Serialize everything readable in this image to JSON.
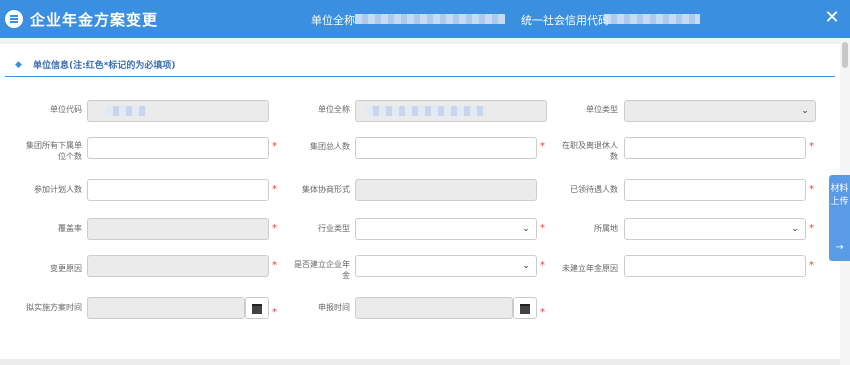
{
  "header": {
    "title": "企业年金方案变更",
    "unit_name_label": "单位全称",
    "credit_code_label": "统一社会信用代码",
    "close_label": "✕"
  },
  "section": {
    "title": "单位信息(注:红色*标记的为必填项)",
    "icon": "diamond-icon"
  },
  "form": {
    "unit_code_label": "单位代码",
    "unit_fullname_label": "单位全称",
    "unit_type_label": "单位类型",
    "subsidiary_count_label": "集团所有下属单位个数",
    "group_total_label": "集团总人数",
    "active_retired_label": "在职及离退休人数",
    "participants_label": "参加计划人数",
    "negotiation_label": "集体协商形式",
    "receiving_label": "已领待遇人数",
    "coverage_label": "覆盖率",
    "industry_label": "行业类型",
    "location_label": "所属地",
    "change_reason_label": "变更原因",
    "has_annuity_label": "是否建立企业年金",
    "no_annuity_reason_label": "未建立年金原因",
    "plan_time_label": "拟实施方案时间",
    "apply_time_label": "申报时间",
    "required_mark": "*"
  },
  "side_tab": {
    "label": "材料上传",
    "arrow": "→"
  },
  "colors": {
    "accent": "#3b8fe0",
    "required": "#e64040",
    "disabled_bg": "#ebebeb"
  }
}
